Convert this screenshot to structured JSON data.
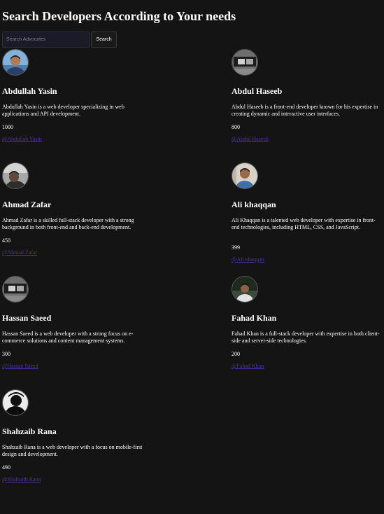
{
  "header": {
    "title": "Search Developers According to Your needs"
  },
  "search": {
    "placeholder": "Search Advocates",
    "value": "",
    "button_label": "Search"
  },
  "developers": [
    {
      "name": "Abdullah Yasin",
      "description": "Abdullah Yasin is a web developer specializing in web applications and API development.",
      "count": "1000",
      "handle": "@Abdullah Yasin"
    },
    {
      "name": "Abdul Haseeb",
      "description": "Abdul Haseeb is a front-end developer known for his expertise in creating dynamic and interactive user interfaces.",
      "count": "800",
      "handle": "@Abdul Haseeb"
    },
    {
      "name": "Ahmad Zafar",
      "description": "Ahmad Zafar is a skilled full-stack developer with a strong background in both front-end and back-end development.",
      "count": "450",
      "handle": "@Ahmad Zafar"
    },
    {
      "name": "Ali khaqqan",
      "description": "Ali Khaqqan is a talented web developer with expertise in front-end technologies, including HTML, CSS, and JavaScript.",
      "count": "399",
      "handle": "@Ali khaqqan"
    },
    {
      "name": "Hassan Saeed",
      "description": "Hassan Saeed is a web developer with a strong focus on e-commerce solutions and content management systems.",
      "count": "300",
      "handle": "@Hassan Saeed"
    },
    {
      "name": "Fahad Khan",
      "description": "Fahad Khan is a full-stack developer with expertise in both client-side and server-side technologies.",
      "count": "200",
      "handle": "@Fahad Khan"
    },
    {
      "name": "Shahzaib Rana",
      "description": "Shahzaib Rana is a web developer with a focus on mobile-first design and development.",
      "count": "490",
      "handle": "@Shahzaib Rana"
    }
  ],
  "colors": {
    "background": "#141414",
    "text": "#ffffff",
    "link": "#4f2fae",
    "input_background": "#1b1b28"
  }
}
